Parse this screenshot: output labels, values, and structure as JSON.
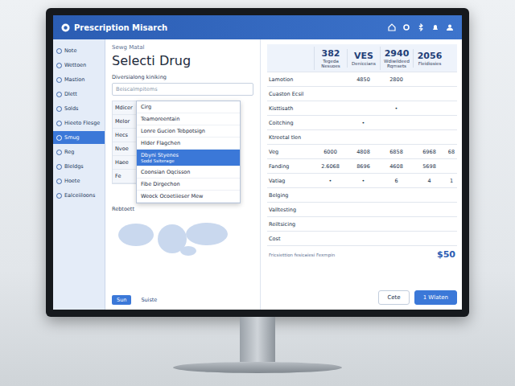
{
  "window": {
    "title": "Prescription Misarch"
  },
  "sidebar": {
    "items": [
      {
        "label": "Note",
        "selected": false
      },
      {
        "label": "Wettoen",
        "selected": false
      },
      {
        "label": "Mastion",
        "selected": false
      },
      {
        "label": "Dlett",
        "selected": false
      },
      {
        "label": "Solds",
        "selected": false
      },
      {
        "label": "Hieeto Flesge",
        "selected": false
      },
      {
        "label": "Smug",
        "selected": true
      },
      {
        "label": "Reg",
        "selected": false
      },
      {
        "label": "Bleldgs",
        "selected": false
      },
      {
        "label": "Hoete",
        "selected": false
      },
      {
        "label": "Ealceiiloons",
        "selected": false
      }
    ]
  },
  "breadcrumb": "Sewg Matal",
  "heading": "Selecti Drug",
  "field": {
    "label": "Diversialong kiniking",
    "placeholder": "Beiscalmpitems"
  },
  "left_list": [
    "Mdicer",
    "Melor",
    "Hecs",
    "Nvoe",
    "Haee",
    "Fe"
  ],
  "dropdown": {
    "items": [
      {
        "label": "Cirg",
        "sub": "",
        "selected": false
      },
      {
        "label": "Teamoreentain",
        "sub": "",
        "selected": false
      },
      {
        "label": "Lonre Gucion Tebpotsign",
        "sub": "",
        "selected": false
      },
      {
        "label": "Hlder Flagchen",
        "sub": "",
        "selected": false
      },
      {
        "label": "Dbyni Styenes",
        "sub": "Sodd Ssiterage",
        "selected": true
      },
      {
        "label": "Coonsian Oqcisson",
        "sub": "",
        "selected": false
      },
      {
        "label": "Fibe Dirgechon",
        "sub": "",
        "selected": false
      },
      {
        "label": "Weock Ocoetiieser Mew",
        "sub": "",
        "selected": false
      }
    ]
  },
  "map_label": "Rebtoett",
  "bottom_tabs": [
    {
      "label": "Sun",
      "selected": true
    },
    {
      "label": "Suiste",
      "selected": false
    }
  ],
  "table": {
    "columns": [
      {
        "value": "382",
        "label": "Tegeda Nesuoes"
      },
      {
        "value": "VES",
        "label": "Deniccians"
      },
      {
        "value": "2940",
        "label": "Wdiwildeed Rqmsets"
      },
      {
        "value": "2056",
        "label": "Fleidiosies"
      }
    ],
    "rows": [
      {
        "label": "Lamotion",
        "cells": [
          "",
          "4850",
          "2800",
          "",
          ""
        ]
      },
      {
        "label": "Cuaston Ecsil",
        "cells": [
          "",
          "",
          "",
          "",
          ""
        ]
      },
      {
        "label": "Kisttisath",
        "cells": [
          "",
          "",
          "•",
          "",
          ""
        ]
      },
      {
        "label": "Coitching",
        "cells": [
          "",
          "•",
          "",
          "",
          ""
        ]
      },
      {
        "label": "Ktreetal tlen",
        "cells": [
          "",
          "",
          "",
          "",
          ""
        ]
      },
      {
        "label": "Veg",
        "cells": [
          "6000",
          "4808",
          "6858",
          "6968",
          "68"
        ]
      },
      {
        "label": "Fanding",
        "cells": [
          "2.6068",
          "8696",
          "4608",
          "5698",
          ""
        ]
      },
      {
        "label": "Vatiag",
        "cells": [
          "•",
          "•",
          "6",
          "4",
          "1"
        ]
      },
      {
        "label": "Belging",
        "cells": [
          "",
          "",
          "",
          "",
          ""
        ]
      },
      {
        "label": "Valltesting",
        "cells": [
          "",
          "",
          "",
          "",
          ""
        ]
      },
      {
        "label": "Reiltsicing",
        "cells": [
          "",
          "",
          "",
          "",
          ""
        ]
      },
      {
        "label": "Cost",
        "cells": [
          "",
          "",
          "",
          "",
          ""
        ]
      }
    ]
  },
  "note": "Fricsiettion fesicaiesi Fexmpin",
  "price": "$50",
  "buttons": [
    {
      "label": "Cete",
      "primary": false
    },
    {
      "label": "1 Wlaten",
      "primary": true
    }
  ]
}
